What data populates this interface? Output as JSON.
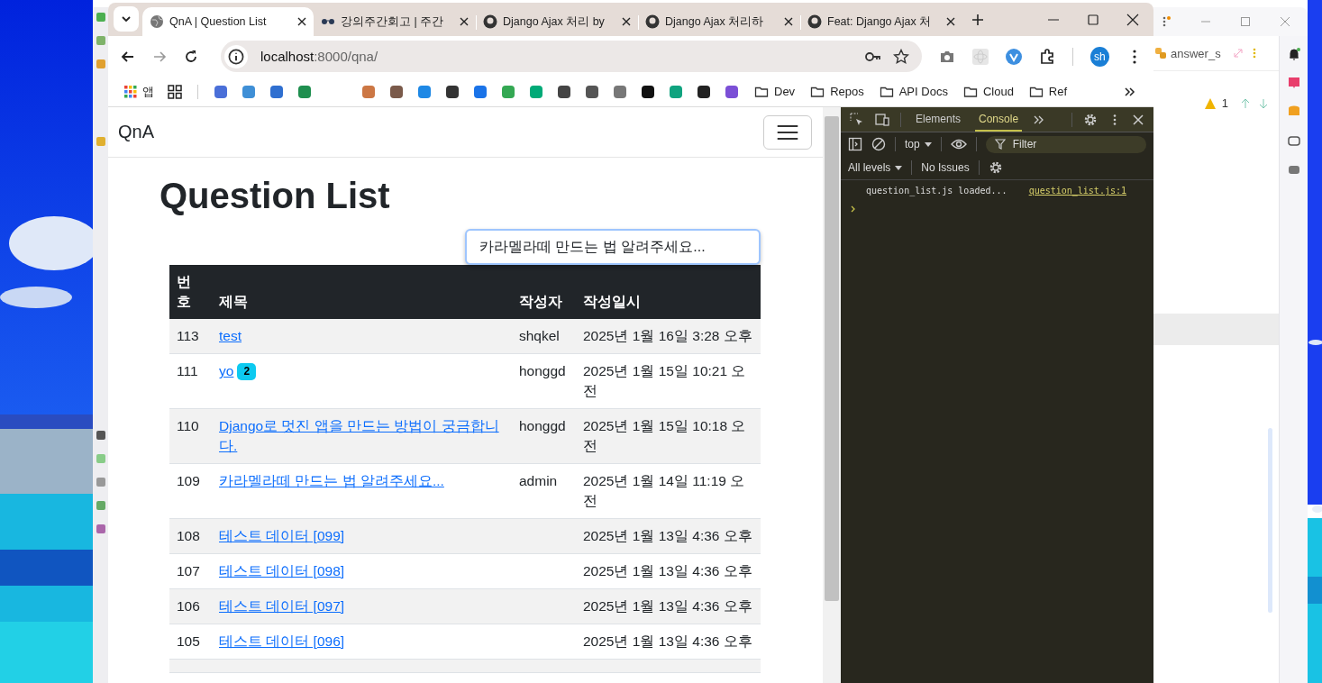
{
  "background_window": {
    "file_tab": "answer_s",
    "warning_count": "1"
  },
  "browser": {
    "tabs": [
      {
        "title": "QnA | Question List",
        "selected": true
      },
      {
        "title": "강의주간회고 | 주간",
        "selected": false
      },
      {
        "title": "Django Ajax 처리 by",
        "selected": false
      },
      {
        "title": "Django Ajax 처리하",
        "selected": false
      },
      {
        "title": "Feat: Django Ajax 처",
        "selected": false
      }
    ],
    "address": {
      "host": "localhost",
      "path": ":8000/qna/"
    },
    "profile": "sh",
    "apps_label": "앱",
    "bookmark_folders": [
      "Dev",
      "Repos",
      "API Docs",
      "Cloud",
      "Ref"
    ]
  },
  "page": {
    "brand": "QnA",
    "heading": "Question List",
    "search": {
      "value": "카라멜라떼 만드는 법 알려주세요..."
    },
    "table": {
      "columns": [
        "번호",
        "제목",
        "작성자",
        "작성일시"
      ],
      "rows": [
        {
          "number": "113",
          "title": "test",
          "author": "shqkel",
          "date": "2025년 1월 16일 3:28 오후"
        },
        {
          "number": "111",
          "title": "yo",
          "answers": "2",
          "author": "honggd",
          "date": "2025년 1월 15일 10:21 오전"
        },
        {
          "number": "110",
          "title": "Django로 멋진 앱을 만드는 방법이 궁금합니다.",
          "author": "honggd",
          "date": "2025년 1월 15일 10:18 오전"
        },
        {
          "number": "109",
          "title": "카라멜라떼 만드는 법 알려주세요...",
          "author": "admin",
          "date": "2025년 1월 14일 11:19 오전"
        },
        {
          "number": "108",
          "title": "테스트 데이터 [099]",
          "date": "2025년 1월 13일 4:36 오후"
        },
        {
          "number": "107",
          "title": "테스트 데이터 [098]",
          "date": "2025년 1월 13일 4:36 오후"
        },
        {
          "number": "106",
          "title": "테스트 데이터 [097]",
          "date": "2025년 1월 13일 4:36 오후"
        },
        {
          "number": "105",
          "title": "테스트 데이터 [096]",
          "date": "2025년 1월 13일 4:36 오후"
        }
      ]
    }
  },
  "devtools": {
    "tabs": [
      {
        "label": "Elements",
        "selected": false
      },
      {
        "label": "Console",
        "selected": true
      }
    ],
    "context": "top",
    "filter_placeholder": "Filter",
    "levels": "All levels",
    "issues": "No Issues",
    "messages": [
      {
        "text": "question_list.js loaded...",
        "source": "question_list.js:1"
      }
    ]
  }
}
